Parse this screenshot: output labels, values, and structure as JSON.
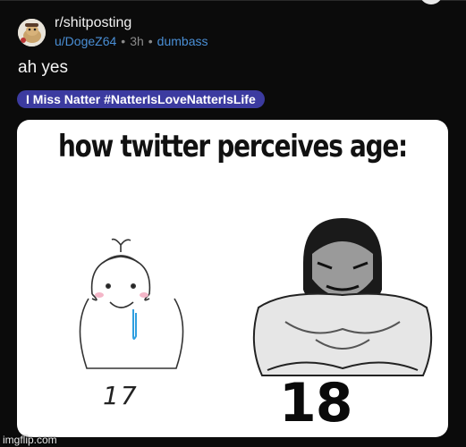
{
  "post": {
    "subreddit": "r/shitposting",
    "username": "u/DogeZ64",
    "age": "3h",
    "user_flair": "dumbass",
    "separator": "•",
    "title": "ah yes",
    "post_flair": "I Miss Natter #NatterIsLoveNatterIsLife"
  },
  "meme": {
    "caption": "how twitter perceives age:",
    "left_label": "17",
    "right_label": "18"
  },
  "watermark": "imgflip.com",
  "colors": {
    "background": "#0b0b0b",
    "link": "#4a8fd6",
    "flair_bg": "#3c3ba0"
  }
}
